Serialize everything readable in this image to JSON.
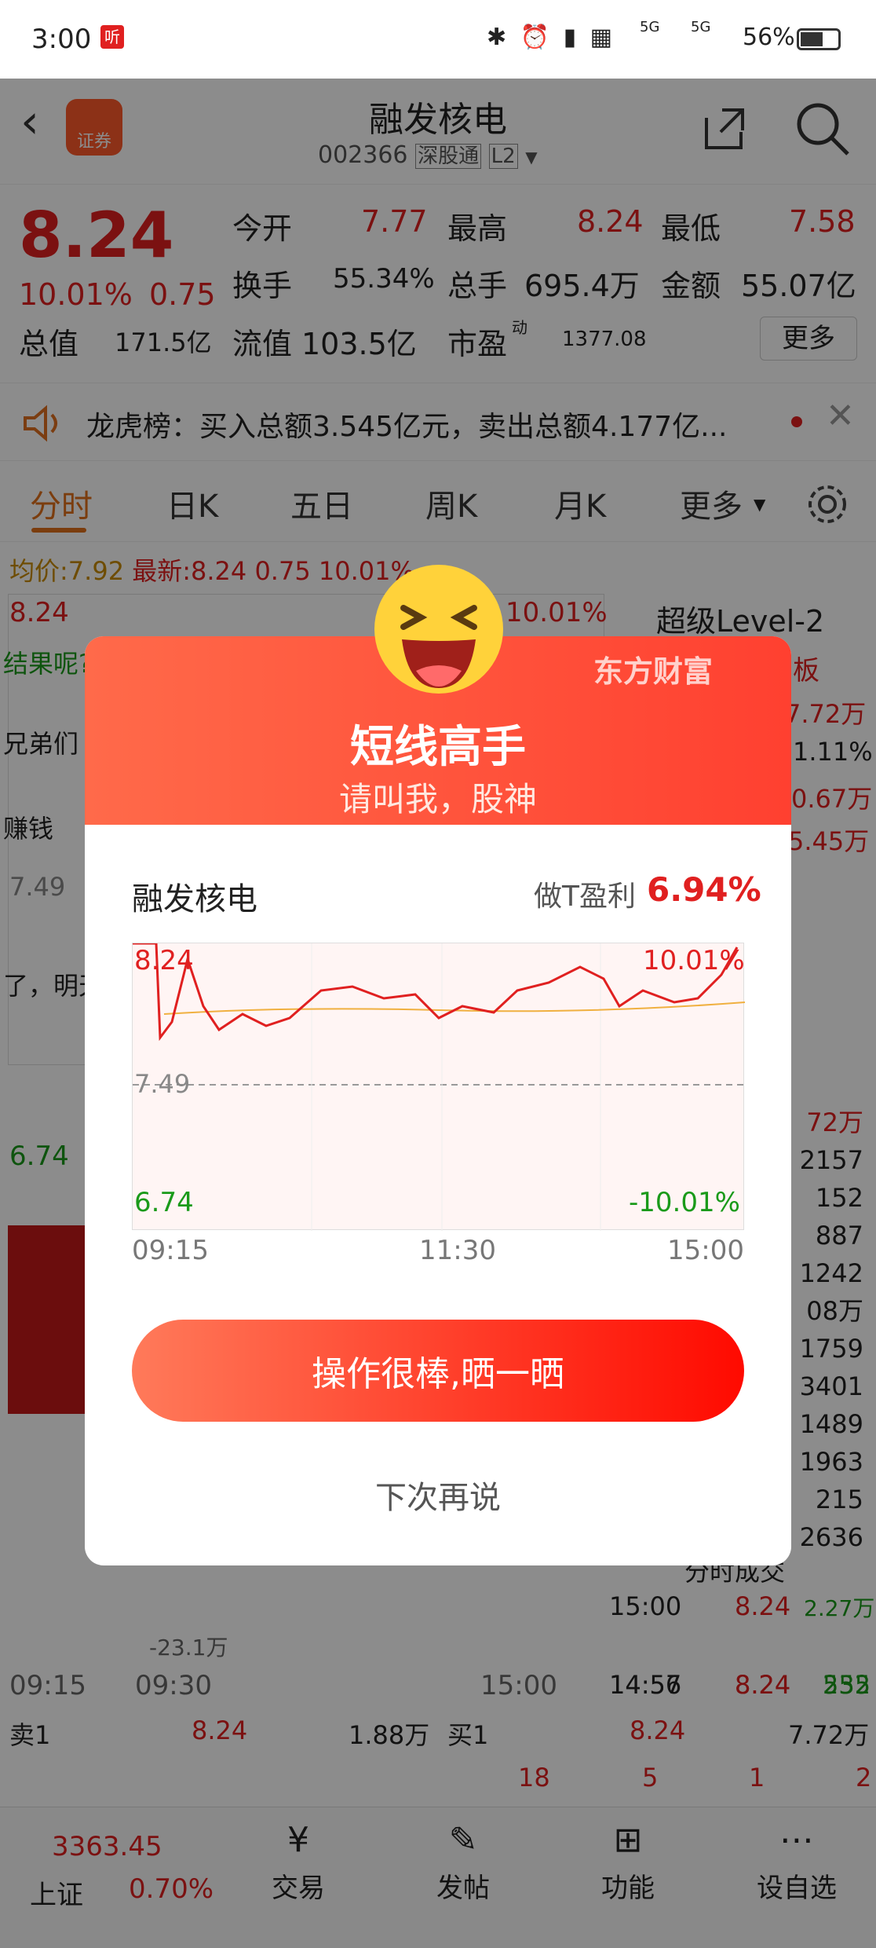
{
  "status_bar": {
    "time": "3:00",
    "app_badge": "听",
    "battery": "56%",
    "net1": "5G",
    "net2": "5G"
  },
  "header": {
    "title": "融发核电",
    "code": "002366",
    "tag1": "深股通",
    "tag2": "L2",
    "logo_text": "证券"
  },
  "quote": {
    "price": "8.24",
    "change_pct": "10.01%",
    "change_amt": "0.75",
    "open_label": "今开",
    "open": "7.77",
    "high_label": "最高",
    "high": "8.24",
    "low_label": "最低",
    "low": "7.58",
    "turnover_label": "换手",
    "turnover": "55.34%",
    "volume_label": "总手",
    "volume": "695.4万",
    "amount_label": "金额",
    "amount": "55.07亿",
    "mcap_label": "总值",
    "mcap": "171.5亿",
    "float_label": "流值",
    "float": "103.5亿",
    "pe_label": "市盈",
    "pe_sup": "动",
    "pe": "1377.08",
    "more_button": "更多"
  },
  "notice": {
    "text": "龙虎榜：买入总额3.545亿元，卖出总额4.177亿..."
  },
  "tabs": [
    "分时",
    "日K",
    "五日",
    "周K",
    "月K",
    "更多"
  ],
  "avg_line": {
    "avg_label": "均价:",
    "avg": "7.92",
    "latest_label": "最新:",
    "latest": "8.24",
    "chg": "0.75",
    "pct": "10.01%"
  },
  "background_chart": {
    "top": "8.24",
    "top_pct": "10.01%",
    "mid": "7.49",
    "low": "6.74",
    "vol": "-23.1万",
    "t1": "09:15",
    "t2": "09:30",
    "t3": "15:00",
    "level2": "超级Level-2",
    "chat1": "结果呢?",
    "chat2": "兄弟们",
    "chat3": "赚钱",
    "chat4": "了，明天",
    "side_board": "板"
  },
  "right_panel": {
    "vals": [
      "7.72万",
      "1.11%",
      "0.67万",
      "5.45万"
    ],
    "book": [
      "72万",
      "2157",
      "152",
      "887",
      "1242",
      "08万",
      "1759",
      "3401",
      "1489",
      "1963",
      "215",
      "2636"
    ],
    "ticks_title": "分时成交",
    "ticks": [
      {
        "time": "15:00",
        "price": "8.24",
        "vol": "2.27万"
      },
      {
        "time": "14:57",
        "price": "8.24",
        "vol": "232"
      },
      {
        "time": "14:56",
        "price": "8.24",
        "vol": "555"
      }
    ]
  },
  "order_book": {
    "sell1_label": "卖1",
    "sell1_price": "8.24",
    "sell1_vol": "1.88万",
    "buy1_label": "买1",
    "buy1_price": "8.24",
    "buy1_vol": "7.72万",
    "q1": "18",
    "q2": "5",
    "q3": "1",
    "q4": "2"
  },
  "bottom_nav": {
    "index_value": "3363.45",
    "index_name": "上证",
    "index_pct": "0.70%",
    "items": [
      "交易",
      "发帖",
      "功能",
      "设自选"
    ]
  },
  "dialog": {
    "brand": "东方财富",
    "title": "短线高手",
    "subtitle": "请叫我，股神",
    "stock_name": "融发核电",
    "profit_label": "做T盈利",
    "profit_value": "6.94%",
    "chart_top": "8.24",
    "chart_top_pct": "10.01%",
    "chart_mid": "7.49",
    "chart_low": "6.74",
    "chart_low_pct": "-10.01%",
    "t_start": "09:15",
    "t_mid": "11:30",
    "t_end": "15:00",
    "share_button": "操作很棒,晒一晒",
    "later_button": "下次再说"
  },
  "colors": {
    "up": "#e02020",
    "down": "#1a9a1a",
    "accent": "#ff4030",
    "tab_active": "#e0701a"
  }
}
